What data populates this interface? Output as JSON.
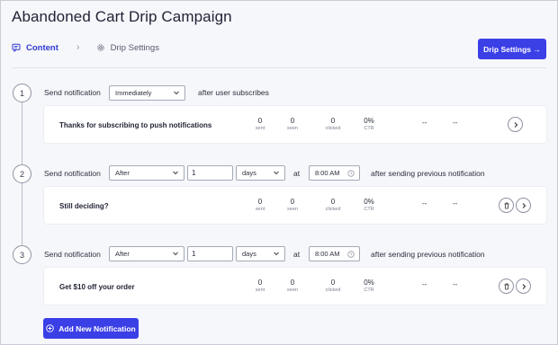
{
  "page": {
    "title": "Abandoned Cart Drip Campaign"
  },
  "tabs": [
    {
      "label": "Content",
      "icon": "message-icon",
      "active": true
    },
    {
      "label": "Drip Settings",
      "icon": "gear-icon",
      "active": false
    }
  ],
  "header": {
    "drip_settings_button": "Drip Settings →"
  },
  "labels": {
    "send_notification": "Send notification",
    "at": "at",
    "after_user_subscribes": "after user subscribes",
    "after_previous": "after sending previous notification",
    "stat_sent": "sent",
    "stat_seen": "seen",
    "stat_clicked": "clicked",
    "stat_ctr": "CTR",
    "dash": "--"
  },
  "steps": [
    {
      "number": "1",
      "timing_select": "Immediately",
      "notification": {
        "title": "Thanks for subscribing to push notifications",
        "sent": "0",
        "seen": "0",
        "clicked": "0",
        "ctr": "0%"
      }
    },
    {
      "number": "2",
      "timing_select": "After",
      "amount": "1",
      "unit_select": "days",
      "time": "8:00 AM",
      "notification": {
        "title": "Still deciding?",
        "sent": "0",
        "seen": "0",
        "clicked": "0",
        "ctr": "0%"
      }
    },
    {
      "number": "3",
      "timing_select": "After",
      "amount": "1",
      "unit_select": "days",
      "time": "8:00 AM",
      "notification": {
        "title": "Get $10 off your order",
        "sent": "0",
        "seen": "0",
        "clicked": "0",
        "ctr": "0%"
      }
    }
  ],
  "footer": {
    "add_button": "Add New Notification"
  },
  "colors": {
    "primary": "#3b3fe6",
    "tab_active": "#2f3ad0",
    "background": "#f6f7fb"
  }
}
